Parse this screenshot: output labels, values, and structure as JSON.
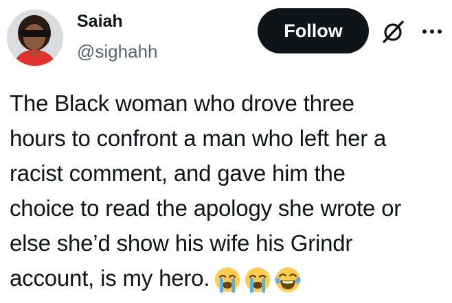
{
  "author": {
    "display_name": "Saiah",
    "handle": "@sighahh"
  },
  "actions": {
    "follow_label": "Follow",
    "grok_icon": "grok-icon",
    "more_icon": "more-icon"
  },
  "tweet": {
    "lines": [
      "The Black woman who drove three",
      "hours to confront a man who left her a",
      "racist comment, and gave him the",
      "choice to read the apology she wrote or",
      "else she’d show his wife his Grindr",
      "account, is my hero."
    ],
    "emojis": [
      "loudly-crying-face",
      "loudly-crying-face",
      "face-with-tears-of-joy"
    ]
  },
  "colors": {
    "text": "#0f1419",
    "secondary_text": "#536471",
    "follow_bg": "#0f1419",
    "follow_text": "#ffffff",
    "emoji_yellow": "#ffcc4d",
    "tears_blue": "#5dadec"
  }
}
